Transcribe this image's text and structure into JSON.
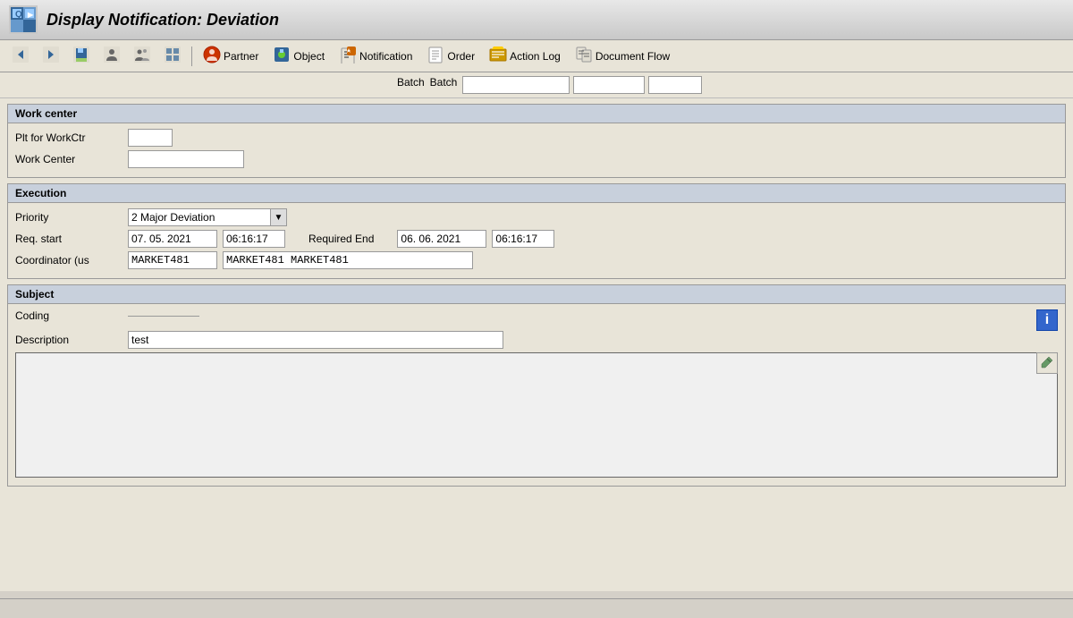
{
  "titleBar": {
    "iconText": "Q",
    "title": "Display Notification: Deviation"
  },
  "toolbar": {
    "buttons": [
      {
        "name": "back-btn",
        "label": "",
        "icon": "◀",
        "iconName": "back-icon"
      },
      {
        "name": "forward-btn",
        "label": "",
        "icon": "▶",
        "iconName": "forward-icon"
      },
      {
        "name": "save-btn",
        "label": "",
        "icon": "💾",
        "iconName": "save-icon"
      },
      {
        "name": "person-btn",
        "label": "",
        "icon": "👤",
        "iconName": "person-icon"
      },
      {
        "name": "person2-btn",
        "label": "",
        "icon": "👥",
        "iconName": "persons-icon"
      },
      {
        "name": "grid-btn",
        "label": "",
        "icon": "▦",
        "iconName": "grid-icon"
      },
      {
        "name": "partner-btn",
        "label": "Partner",
        "icon": "🔴",
        "iconName": "partner-icon"
      },
      {
        "name": "object-btn",
        "label": "Object",
        "icon": "🟢",
        "iconName": "object-icon"
      },
      {
        "name": "notification-btn",
        "label": "Notification",
        "icon": "📋",
        "iconName": "notification-icon"
      },
      {
        "name": "order-btn",
        "label": "Order",
        "icon": "📄",
        "iconName": "order-icon"
      },
      {
        "name": "action-log-btn",
        "label": "Action Log",
        "icon": "🟡",
        "iconName": "action-log-icon"
      },
      {
        "name": "document-flow-btn",
        "label": "Document Flow",
        "icon": "📊",
        "iconName": "document-flow-icon"
      }
    ]
  },
  "topPartial": {
    "label": "Batch",
    "input1": "",
    "input2": "",
    "input3": ""
  },
  "workCenter": {
    "sectionTitle": "Work center",
    "pltLabel": "Plt for WorkCtr",
    "pltValue": "",
    "wcLabel": "Work Center",
    "wcValue": ""
  },
  "execution": {
    "sectionTitle": "Execution",
    "priorityLabel": "Priority",
    "priorityValue": "2 Major Deviation",
    "reqStartLabel": "Req. start",
    "reqStartDate": "07. 05. 2021",
    "reqStartTime": "06:16:17",
    "reqEndLabel": "Required End",
    "reqEndDate": "06. 06. 2021",
    "reqEndTime": "06:16:17",
    "coordinatorLabel": "Coordinator (us",
    "coordinatorId": "MARKET481",
    "coordinatorName": "MARKET481 MARKET481"
  },
  "subject": {
    "sectionTitle": "Subject",
    "codingLabel": "Coding",
    "descriptionLabel": "Description",
    "descriptionValue": "test",
    "textAreaValue": ""
  }
}
